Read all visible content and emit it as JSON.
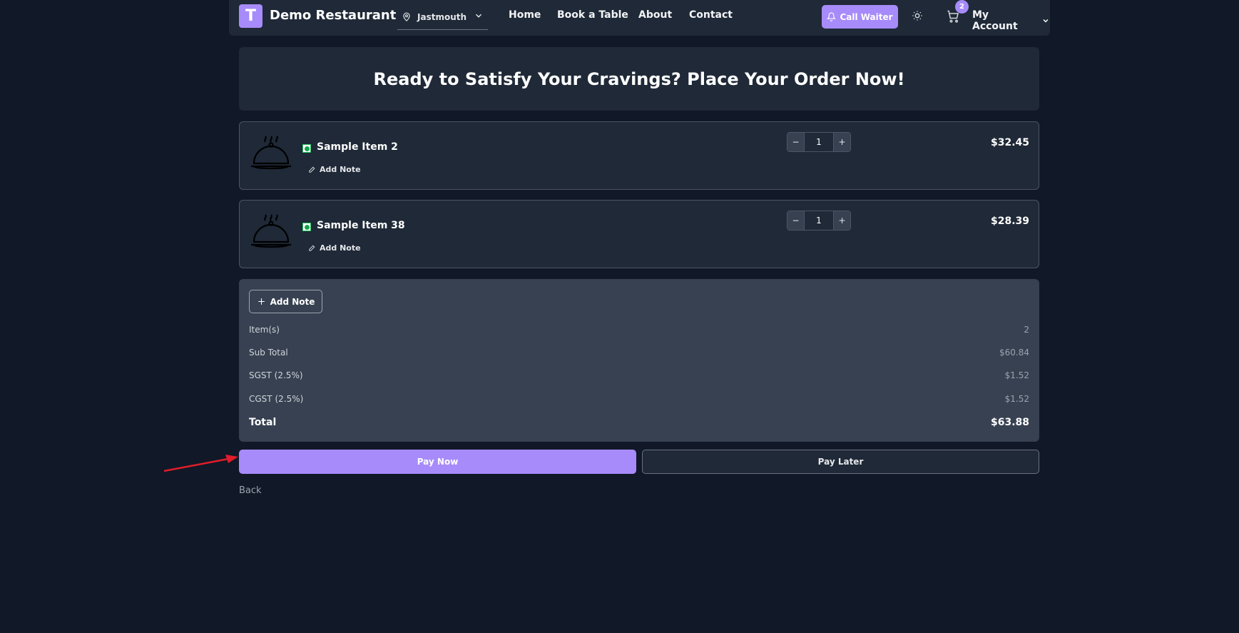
{
  "header": {
    "logo_letter": "T",
    "brand": "Demo Restaurant",
    "location": "Jastmouth",
    "nav": [
      "Home",
      "Book a Table",
      "About",
      "Contact"
    ],
    "call_waiter": "Call Waiter",
    "cart_count": "2",
    "account": "My Account"
  },
  "hero": {
    "title": "Ready to Satisfy Your Cravings? Place Your Order Now!"
  },
  "items": [
    {
      "name": "Sample Item 2",
      "note_label": "Add Note",
      "quantity": "1",
      "price": "$32.45"
    },
    {
      "name": "Sample Item 38",
      "note_label": "Add Note",
      "quantity": "1",
      "price": "$28.39"
    }
  ],
  "summary": {
    "add_note": "Add Note",
    "rows": [
      {
        "label": "Item(s)",
        "value": "2"
      },
      {
        "label": "Sub Total",
        "value": "$60.84"
      },
      {
        "label": "SGST (2.5%)",
        "value": "$1.52"
      },
      {
        "label": "CGST (2.5%)",
        "value": "$1.52"
      }
    ],
    "total_label": "Total",
    "total_value": "$63.88"
  },
  "actions": {
    "pay_now": "Pay Now",
    "pay_later": "Pay Later",
    "back": "Back"
  },
  "colors": {
    "accent": "#a78bfa",
    "background": "#111827",
    "card": "#1f2937",
    "summary_bg": "#374151",
    "veg": "#16a34a",
    "annotation_arrow": "#e11d2a"
  },
  "icons": [
    "location-pin-icon",
    "chevron-down-icon",
    "bell-icon",
    "sun-icon",
    "cart-icon",
    "cloche-icon",
    "pencil-icon",
    "plus-icon",
    "minus-icon"
  ]
}
